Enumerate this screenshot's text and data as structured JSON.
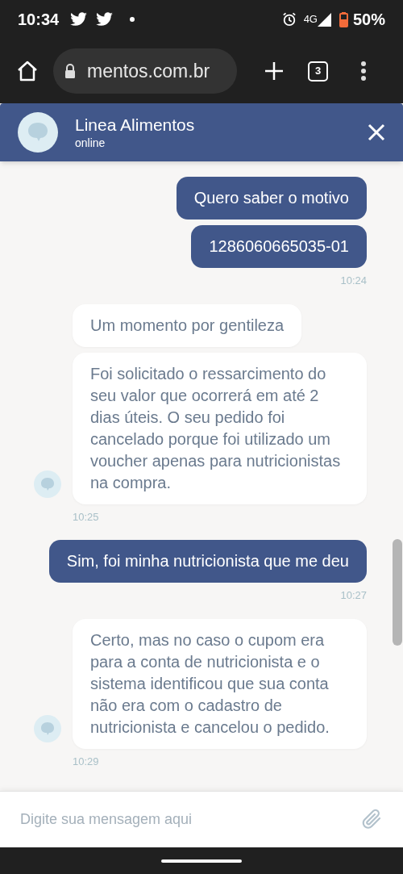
{
  "status_bar": {
    "time": "10:34",
    "network": "4G",
    "battery": "50%"
  },
  "browser": {
    "url": "mentos.com.br",
    "tab_count": "3"
  },
  "chat_header": {
    "title": "Linea Alimentos",
    "status": "online"
  },
  "messages": [
    {
      "kind": "sent",
      "bubbles": [
        "Quero saber o motivo",
        "1286060665035-01"
      ],
      "time": "10:24"
    },
    {
      "kind": "received",
      "bubbles": [
        "Um momento por gentileza",
        "Foi solicitado o ressarcimento do seu valor que ocorrerá em até 2 dias úteis. O seu pedido foi cancelado porque foi utilizado um voucher apenas para nutricionistas na compra."
      ],
      "time": "10:25"
    },
    {
      "kind": "sent",
      "bubbles": [
        "Sim, foi minha nutricionista que me deu"
      ],
      "time": "10:27"
    },
    {
      "kind": "received",
      "bubbles": [
        "Certo, mas no caso o cupom era para a conta de nutricionista e o sistema identificou que sua conta não era com o cadastro de nutricionista e cancelou o pedido."
      ],
      "time": "10:29"
    }
  ],
  "composer": {
    "placeholder": "Digite sua mensagem aqui"
  }
}
